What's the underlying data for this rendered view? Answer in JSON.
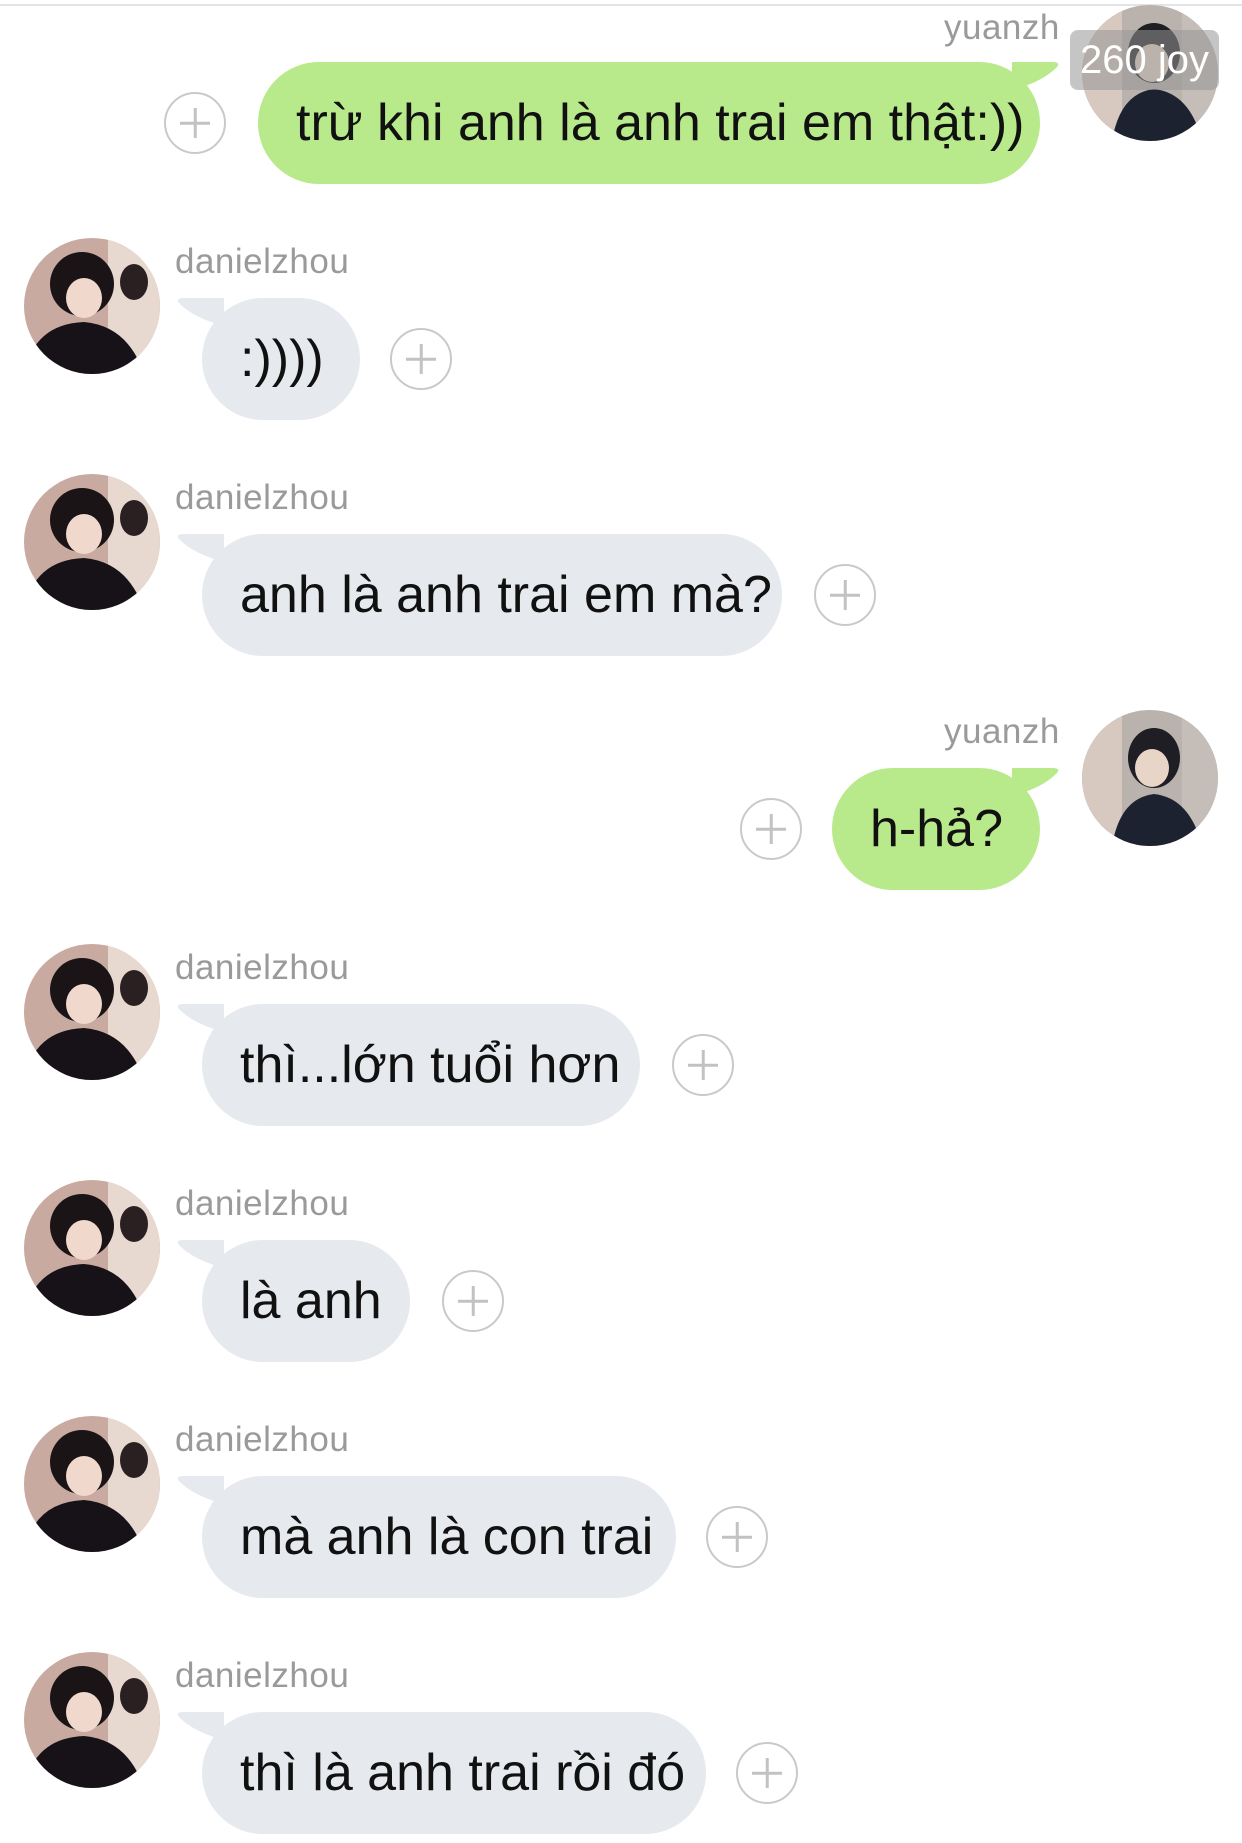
{
  "watermark": "260 joy",
  "messages": [
    {
      "side": "out",
      "user": "yuanzh",
      "text": "trừ khi anh là anh trai em thật:))"
    },
    {
      "side": "in",
      "user": "danielzhou",
      "text": ":))))"
    },
    {
      "side": "in",
      "user": "danielzhou",
      "text": "anh là anh trai em mà?"
    },
    {
      "side": "out",
      "user": "yuanzh",
      "text": "h-hả?"
    },
    {
      "side": "in",
      "user": "danielzhou",
      "text": "thì...lớn tuổi hơn"
    },
    {
      "side": "in",
      "user": "danielzhou",
      "text": "là anh"
    },
    {
      "side": "in",
      "user": "danielzhou",
      "text": "mà anh là con trai"
    },
    {
      "side": "in",
      "user": "danielzhou",
      "text": "thì là anh trai rồi đó"
    }
  ],
  "colors": {
    "outgoing_bubble": "#b8ea8c",
    "incoming_bubble": "#e6e9ee",
    "username": "#9a9a9a",
    "plus_button": "#c9c9c9"
  },
  "icons": {
    "add_reaction": "plus-circle-icon",
    "avatar": "user-avatar"
  }
}
